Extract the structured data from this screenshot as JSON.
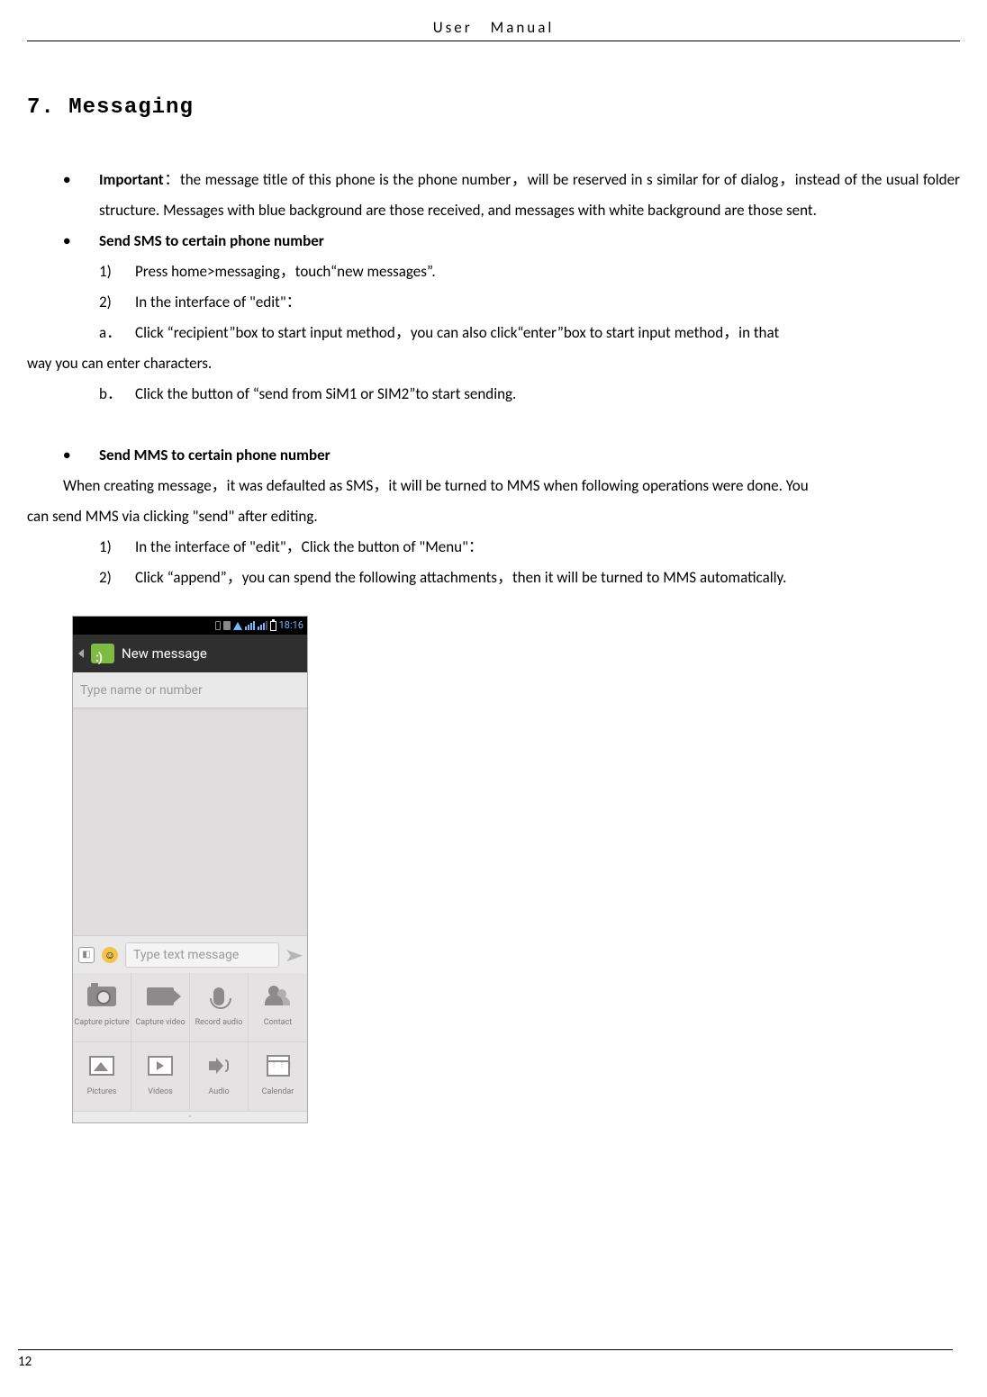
{
  "header": {
    "title": "User Manual"
  },
  "section": {
    "number": "7.",
    "title": "Messaging"
  },
  "body": {
    "bul1_strong": "Important",
    "bul1_rest": "：the message title of this phone is the phone number，will be reserved in s similar for of dialog，instead of the usual folder structure. Messages with blue background are those received, and messages with white background are those sent.",
    "bul2": "Send SMS to certain phone number",
    "n1_num": "1)",
    "n1_txt": "Press home>messaging，touch“new messages”.",
    "n2_num": "2)",
    "n2_txt": "In the interface of \"edit\"：",
    "a_let": "a．",
    "a_txt_part": "Click “recipient”box to start input method，you can also click“enter”box to start input method，in that",
    "a_cont": "way you can enter characters.",
    "b_let": "b．",
    "b_txt": "Click the button of  “send from SiM1 or SIM2”to start sending.",
    "bul3": "Send MMS to certain phone number",
    "mms_intro1": "When creating message，it was defaulted as SMS，it will be turned to MMS when following operations were done. You",
    "mms_intro2": "can send MMS via clicking \"send\" after editing.",
    "m1_num": "1)",
    "m1_txt": "In the interface of \"edit\"，Click the button of \"Menu\"：",
    "m2_num": "2)",
    "m2_txt": "Click  “append”，you can spend the following attachments，then it will be turned to MMS automatically."
  },
  "phone": {
    "clock": "18:16",
    "title": "New message",
    "recipient_placeholder": "Type name or number",
    "compose_placeholder": "Type text message",
    "att": {
      "a1": "Capture picture",
      "a2": "Capture video",
      "a3": "Record audio",
      "a4": "Contact",
      "a5": "Pictures",
      "a6": "Videos",
      "a7": "Audio",
      "a8": "Calendar"
    }
  },
  "page_number": "12"
}
